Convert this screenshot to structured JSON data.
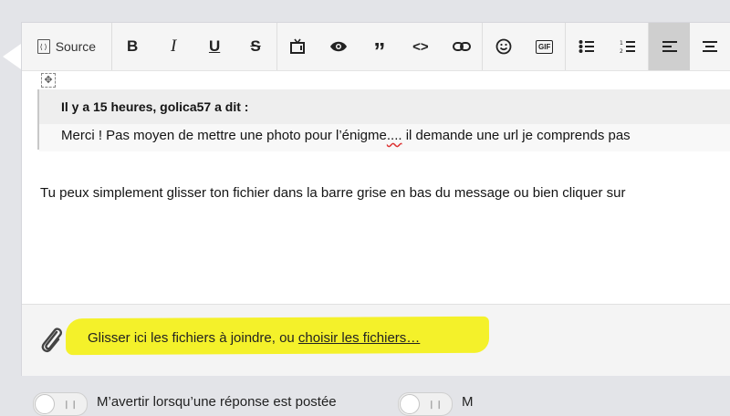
{
  "toolbar": {
    "source_label": "Source",
    "buttons": [
      {
        "name": "bold",
        "glyph": "B"
      },
      {
        "name": "italic",
        "glyph": "I"
      },
      {
        "name": "underline",
        "glyph": "U"
      },
      {
        "name": "strikethrough",
        "glyph": "S"
      },
      {
        "name": "media",
        "glyph": "📺"
      },
      {
        "name": "spoiler",
        "glyph": "👁"
      },
      {
        "name": "quote",
        "glyph": "❞"
      },
      {
        "name": "code",
        "glyph": "<>"
      },
      {
        "name": "link",
        "glyph": "🔗"
      },
      {
        "name": "emoji",
        "glyph": "☺"
      },
      {
        "name": "gif",
        "glyph": "GIF"
      },
      {
        "name": "bullet-list",
        "glyph": "☰"
      },
      {
        "name": "numbered-list",
        "glyph": "☷"
      },
      {
        "name": "align-left",
        "glyph": "≡"
      },
      {
        "name": "align-center",
        "glyph": "≡"
      }
    ]
  },
  "quote": {
    "header": "Il y a 15 heures, golica57 a dit :",
    "body_before": "Merci ! Pas moyen de mettre une photo pour l’énigme",
    "body_misspelled": "....",
    "body_after": " il demande une url je comprends pas"
  },
  "reply_text": "Tu peux simplement glisser ton fichier dans la barre grise en bas du message ou bien cliquer sur",
  "attachments": {
    "text": "Glisser ici les fichiers à joindre, ou ",
    "link": "choisir les fichiers…"
  },
  "options": {
    "option1_label": "M’avertir lorsqu’une réponse est postée",
    "option2_label": "M"
  },
  "colors": {
    "highlight": "#f4f12a",
    "toolbar_bg": "#f5f5f5",
    "page_bg": "#e3e4e8"
  }
}
